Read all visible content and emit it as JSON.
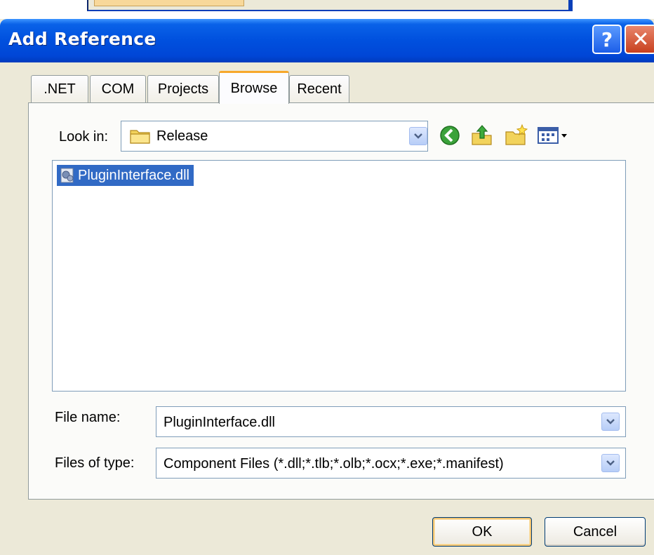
{
  "window": {
    "title": "Add Reference",
    "help_glyph": "?",
    "close_glyph": "✕"
  },
  "tabs": [
    {
      "label": ".NET",
      "active": false
    },
    {
      "label": "COM",
      "active": false
    },
    {
      "label": "Projects",
      "active": false
    },
    {
      "label": "Browse",
      "active": true
    },
    {
      "label": "Recent",
      "active": false
    }
  ],
  "look_in": {
    "label": "Look in:",
    "value": "Release",
    "icon": "folder-icon"
  },
  "toolbar": {
    "icons": [
      "back-icon",
      "up-folder-icon",
      "new-folder-icon",
      "views-menu-icon"
    ]
  },
  "file_list": {
    "items": [
      {
        "name": "PluginInterface.dll",
        "icon": "dll-icon",
        "selected": true
      }
    ]
  },
  "file_name": {
    "label": "File name:",
    "value": "PluginInterface.dll"
  },
  "files_of_type": {
    "label": "Files of type:",
    "value": "Component Files (*.dll;*.tlb;*.olb;*.ocx;*.exe;*.manifest)"
  },
  "buttons": {
    "ok": "OK",
    "cancel": "Cancel"
  },
  "colors": {
    "titlebar": "#0050de",
    "dialog_bg": "#ece9d8",
    "selection": "#316ac5",
    "active_tab_accent": "#f7a82b"
  }
}
